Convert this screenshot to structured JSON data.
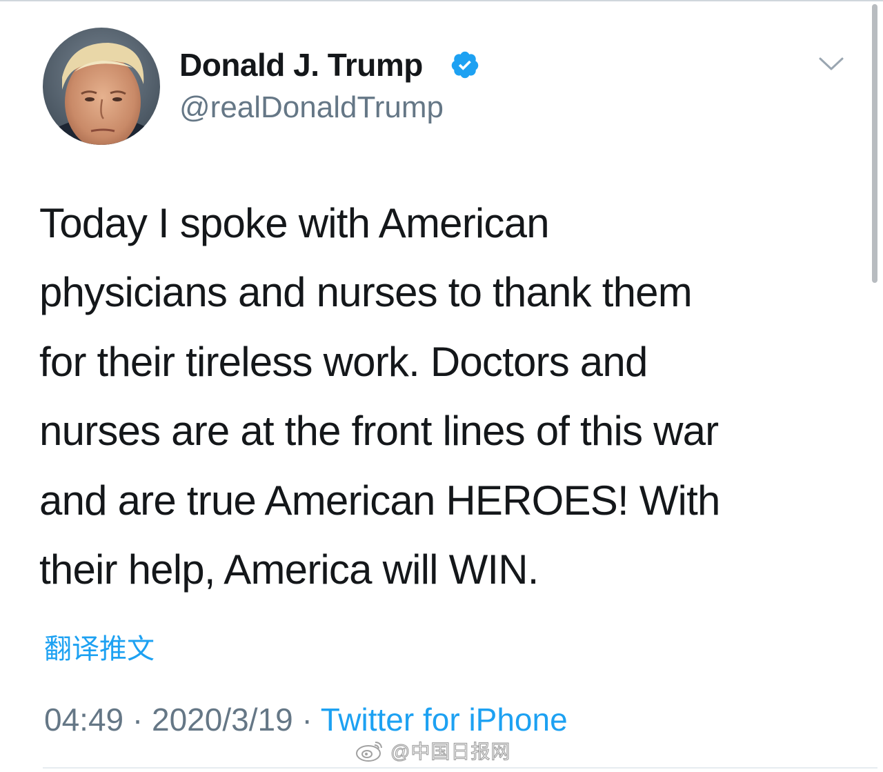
{
  "tweet": {
    "author": {
      "display_name": "Donald J. Trump",
      "handle": "@realDonaldTrump",
      "verified": true
    },
    "text_lines": [
      "Today I spoke with American",
      "physicians and nurses to thank them",
      "for their tireless work. Doctors and",
      "nurses are at the front lines of this war",
      "and are true American HEROES! With",
      "their help, America will WIN."
    ],
    "translate_label": "翻译推文",
    "meta": {
      "time": "04:49",
      "separator": "·",
      "date": "2020/3/19",
      "source": "Twitter for iPhone"
    }
  },
  "watermark": {
    "text": "@中国日报网",
    "icon": "weibo-logo-icon"
  },
  "colors": {
    "link_blue": "#1da1f2",
    "secondary_gray": "#657786",
    "text_black": "#14171a",
    "verified_blue": "#1da1f2"
  },
  "icons": {
    "verified": "verified-badge-icon",
    "menu": "chevron-down-icon"
  }
}
